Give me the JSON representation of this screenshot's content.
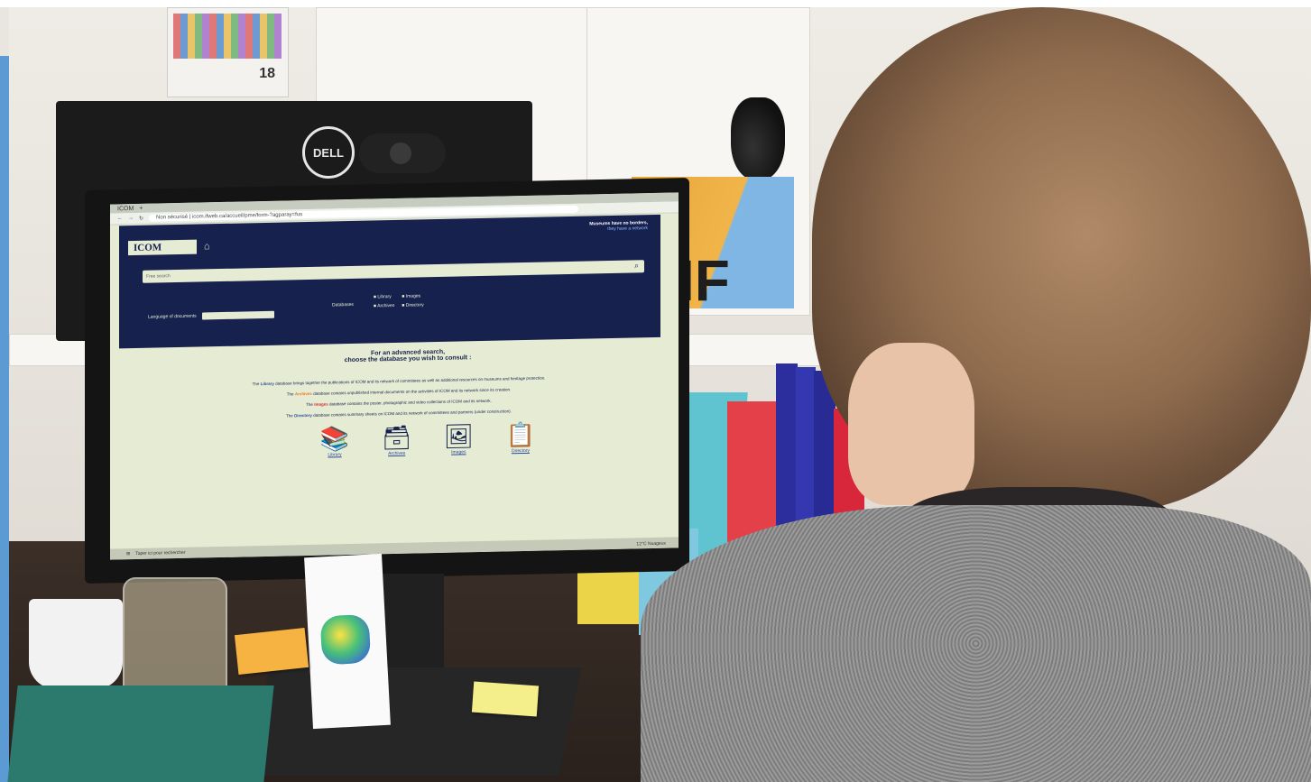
{
  "photo": {
    "monitor_brand": "DELL",
    "poster_number": "18",
    "flag_text": "IF",
    "accent_colors": {
      "icom_navy": "#16214e",
      "screen_bg": "#e6ecd3",
      "link_blue": "#2a4a9c",
      "archives_orange": "#e07b22",
      "images_red": "#d22d2d"
    }
  },
  "browser": {
    "tab_title": "ICOM",
    "address": "Non sécurisé | icom.ifweb.ca/accueil/pme/form-?agparay=fus"
  },
  "site": {
    "logo_text": "ICOM",
    "slogan": "Museums have no borders,",
    "slogan_sub": "they have a network",
    "search_placeholder": "Free search",
    "language_label": "Language of documents",
    "databases_label": "Databases",
    "db_options": [
      "Library",
      "Images",
      "Archives",
      "Directory"
    ],
    "advanced_line1": "For an advanced search,",
    "advanced_line2": "choose the database you wish to consult :",
    "descriptions": [
      {
        "pre": "The ",
        "name": "Library",
        "post": " database brings together the publications of ICOM and its network of committees as well as additional resources on museums and heritage protection."
      },
      {
        "pre": "The ",
        "name": "Archives",
        "post": " database contains unpublished internal documents on the activities of ICOM and its network since its creation."
      },
      {
        "pre": "The ",
        "name": "Images",
        "post": " database contains the poster, photographic and video collections of ICOM and its network."
      },
      {
        "pre": "The ",
        "name": "Directory",
        "post": " database contains summary sheets on ICOM and its network of committees and partners (under construction)."
      }
    ],
    "categories": [
      {
        "label": "Library",
        "icon": "books-icon",
        "glyph": "📚"
      },
      {
        "label": "Archives",
        "icon": "archive-box-icon",
        "glyph": "🗃"
      },
      {
        "label": "Images",
        "icon": "image-icon",
        "glyph": "🖼"
      },
      {
        "label": "Directory",
        "icon": "clipboard-icon",
        "glyph": "📋"
      }
    ]
  },
  "taskbar": {
    "search_placeholder": "Taper ici pour rechercher",
    "weather": "12°C Nuageux"
  }
}
